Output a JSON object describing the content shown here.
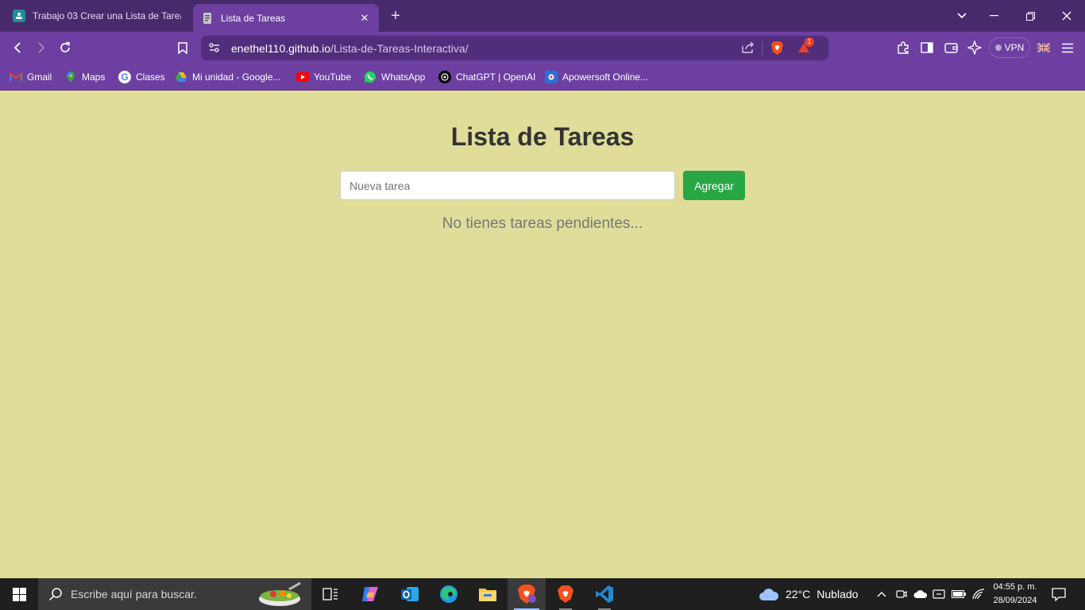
{
  "browser": {
    "tabs": [
      {
        "title": "Trabajo 03 Crear una Lista de Tareas",
        "active": false
      },
      {
        "title": "Lista de Tareas",
        "active": true
      }
    ],
    "address": {
      "domain": "enethel110.github.io",
      "path": "/Lista-de-Tareas-Interactiva/"
    },
    "rewards_badge": "1",
    "vpn_label": "VPN",
    "bookmarks": [
      {
        "label": "Gmail",
        "icon": "gmail-icon"
      },
      {
        "label": "Maps",
        "icon": "maps-icon"
      },
      {
        "label": "Clases",
        "icon": "google-icon"
      },
      {
        "label": "Mi unidad - Google...",
        "icon": "drive-icon"
      },
      {
        "label": "YouTube",
        "icon": "youtube-icon"
      },
      {
        "label": "WhatsApp",
        "icon": "whatsapp-icon"
      },
      {
        "label": "ChatGPT | OpenAI",
        "icon": "openai-icon"
      },
      {
        "label": "Apowersoft Online...",
        "icon": "apowersoft-icon"
      }
    ]
  },
  "page": {
    "title": "Lista de Tareas",
    "input_placeholder": "Nueva tarea",
    "input_value": "",
    "add_button": "Agregar",
    "empty_message": "No tienes tareas pendientes...",
    "background_color": "#e0dd9a",
    "button_color": "#28a745"
  },
  "taskbar": {
    "search_placeholder": "Escribe aquí para buscar.",
    "weather": {
      "temp": "22°C",
      "condition": "Nublado"
    },
    "time": "04:55 p. m.",
    "date": "28/09/2024"
  }
}
